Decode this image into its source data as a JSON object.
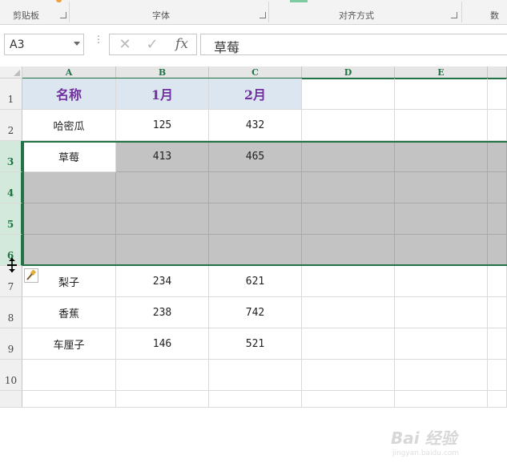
{
  "ribbon": {
    "groups": [
      "剪贴板",
      "字体",
      "对齐方式",
      "数"
    ]
  },
  "formula_bar": {
    "name_box": "A3",
    "cancel_icon": "✕",
    "enter_icon": "✓",
    "fx_label": "fx",
    "content": "草莓"
  },
  "columns": [
    "A",
    "B",
    "C",
    "D",
    "E"
  ],
  "rows": [
    {
      "num": "1",
      "cells": [
        "名称",
        "1月",
        "2月"
      ]
    },
    {
      "num": "2",
      "cells": [
        "哈密瓜",
        "125",
        "432"
      ]
    },
    {
      "num": "3",
      "cells": [
        "草莓",
        "413",
        "465"
      ]
    },
    {
      "num": "4",
      "cells": [
        "",
        "",
        ""
      ]
    },
    {
      "num": "5",
      "cells": [
        "",
        "",
        ""
      ]
    },
    {
      "num": "6",
      "cells": [
        "",
        "",
        ""
      ]
    },
    {
      "num": "7",
      "cells": [
        "梨子",
        "234",
        "621"
      ]
    },
    {
      "num": "8",
      "cells": [
        "香蕉",
        "238",
        "742"
      ]
    },
    {
      "num": "9",
      "cells": [
        "车厘子",
        "146",
        "521"
      ]
    },
    {
      "num": "10",
      "cells": [
        "",
        "",
        ""
      ]
    }
  ],
  "watermark": {
    "text": "Bai 经验",
    "sub": "jingyan.baidu.com"
  },
  "colors": {
    "accent": "#217346",
    "header_text": "#7030a0",
    "header_fill": "#dce6f1",
    "selection_fill": "#c3c3c3"
  }
}
